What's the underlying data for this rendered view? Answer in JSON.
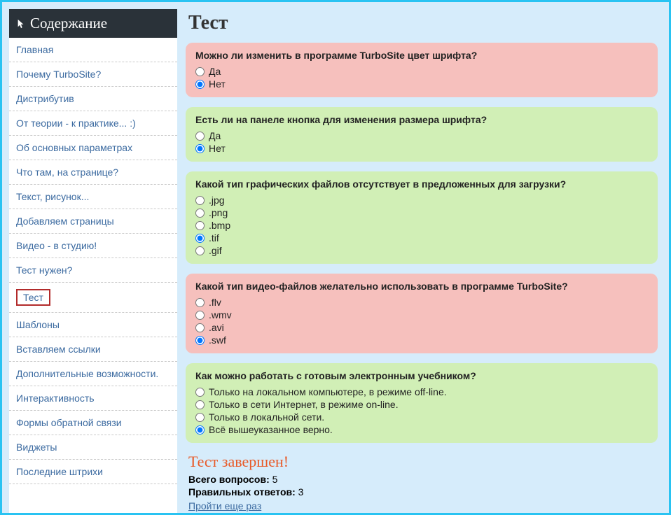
{
  "sidebar": {
    "title": "Содержание",
    "items": [
      {
        "label": "Главная"
      },
      {
        "label": "Почему TurboSite?"
      },
      {
        "label": "Дистрибутив"
      },
      {
        "label": "От теории - к практике... :)"
      },
      {
        "label": "Об основных параметрах"
      },
      {
        "label": "Что там, на странице?"
      },
      {
        "label": "Текст, рисунок..."
      },
      {
        "label": "Добавляем страницы"
      },
      {
        "label": "Видео - в студию!"
      },
      {
        "label": "Тест нужен?"
      },
      {
        "label": "Тест",
        "highlighted": true
      },
      {
        "label": "Шаблоны"
      },
      {
        "label": "Вставляем ссылки"
      },
      {
        "label": "Дополнительные возможности."
      },
      {
        "label": "Интерактивность"
      },
      {
        "label": "Формы обратной связи"
      },
      {
        "label": "Виджеты"
      },
      {
        "label": "Последние штрихи"
      }
    ]
  },
  "main": {
    "title": "Тест",
    "questions": [
      {
        "status": "wrong",
        "text": "Можно ли изменить в программе TurboSite цвет шрифта?",
        "options": [
          {
            "label": "Да",
            "selected": false
          },
          {
            "label": "Нет",
            "selected": true
          }
        ]
      },
      {
        "status": "correct",
        "text": "Есть ли на панеле кнопка для изменения размера шрифта?",
        "options": [
          {
            "label": "Да",
            "selected": false
          },
          {
            "label": "Нет",
            "selected": true
          }
        ]
      },
      {
        "status": "correct",
        "text": "Какой тип графических файлов отсутствует в предложенных для загрузки?",
        "options": [
          {
            "label": ".jpg",
            "selected": false
          },
          {
            "label": ".png",
            "selected": false
          },
          {
            "label": ".bmp",
            "selected": false
          },
          {
            "label": ".tif",
            "selected": true
          },
          {
            "label": ".gif",
            "selected": false
          }
        ]
      },
      {
        "status": "wrong",
        "text": "Какой тип видео-файлов желательно использовать в программе TurboSite?",
        "options": [
          {
            "label": ".flv",
            "selected": false
          },
          {
            "label": ".wmv",
            "selected": false
          },
          {
            "label": ".avi",
            "selected": false
          },
          {
            "label": ".swf",
            "selected": true
          }
        ]
      },
      {
        "status": "correct",
        "text": "Как можно работать с готовым электронным учебником?",
        "options": [
          {
            "label": "Только на локальном компьютере, в режиме off-line.",
            "selected": false
          },
          {
            "label": "Только в сети Интернет, в режиме on-line.",
            "selected": false
          },
          {
            "label": "Только в локальной сети.",
            "selected": false
          },
          {
            "label": "Всё вышеуказанное верно.",
            "selected": true
          }
        ]
      }
    ],
    "result": {
      "title": "Тест завершен!",
      "total_label": "Всего вопросов:",
      "total_value": "5",
      "correct_label": "Правильных ответов:",
      "correct_value": "3",
      "retry_label": "Пройти еще раз"
    }
  }
}
